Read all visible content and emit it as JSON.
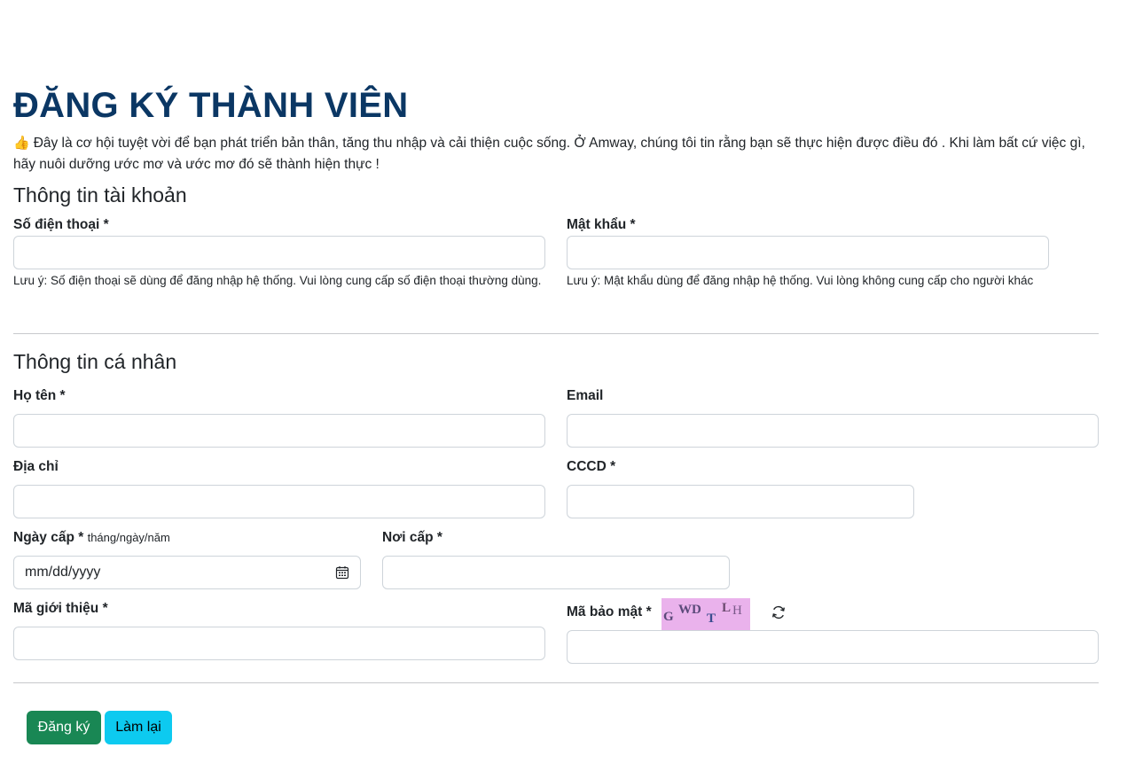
{
  "page": {
    "title": "ĐĂNG KÝ THÀNH VIÊN",
    "intro_icon": "👍",
    "intro": "Đây là cơ hội tuyệt vời để bạn phát triển bản thân, tăng thu nhập và cải thiện cuộc sống. Ở Amway, chúng tôi tin rằng bạn sẽ thực hiện được điều đó . Khi làm bất cứ việc gì, hãy nuôi dưỡng ước mơ và ước mơ đó sẽ thành hiện thực !"
  },
  "account": {
    "section_title": "Thông tin tài khoản",
    "phone": {
      "label": "Số điện thoại",
      "required": "*",
      "value": "",
      "note": "Lưu ý: Số điện thoại sẽ dùng để đăng nhập hệ thống. Vui lòng cung cấp số điện thoại thường dùng."
    },
    "password": {
      "label": "Mật khẩu",
      "required": "*",
      "value": "",
      "note": "Lưu ý: Mật khẩu dùng để đăng nhập hệ thống. Vui lòng không cung cấp cho người khác"
    }
  },
  "personal": {
    "section_title": "Thông tin cá nhân",
    "fullname": {
      "label": "Họ tên",
      "required": "*",
      "value": ""
    },
    "email": {
      "label": "Email",
      "value": ""
    },
    "address": {
      "label": "Địa chỉ",
      "value": ""
    },
    "id_number": {
      "label": "CCCD",
      "required": "*",
      "value": ""
    },
    "issue_date": {
      "label": "Ngày cấp",
      "required": "*",
      "hint": "tháng/ngày/năm",
      "placeholder": "mm/dd/yyyy"
    },
    "issue_place": {
      "label": "Nơi cấp",
      "required": "*",
      "value": ""
    },
    "referral_code": {
      "label": "Mã giới thiệu",
      "required": "*",
      "value": ""
    },
    "captcha": {
      "label": "Mã bảo mật",
      "required": "*",
      "chars": [
        "G",
        "WD",
        "T",
        "L",
        "H"
      ],
      "background": "#eab2ec",
      "text_color": "#5b4a7a",
      "refresh_icon": "refresh-icon",
      "value": ""
    }
  },
  "actions": {
    "submit_label": "Đăng ký",
    "reset_label": "Làm lại",
    "submit_color": "#198754",
    "reset_color": "#0dcaf0"
  },
  "colors": {
    "title": "#0b3764",
    "input_border": "#ced4da",
    "divider": "#c7c9cc"
  }
}
